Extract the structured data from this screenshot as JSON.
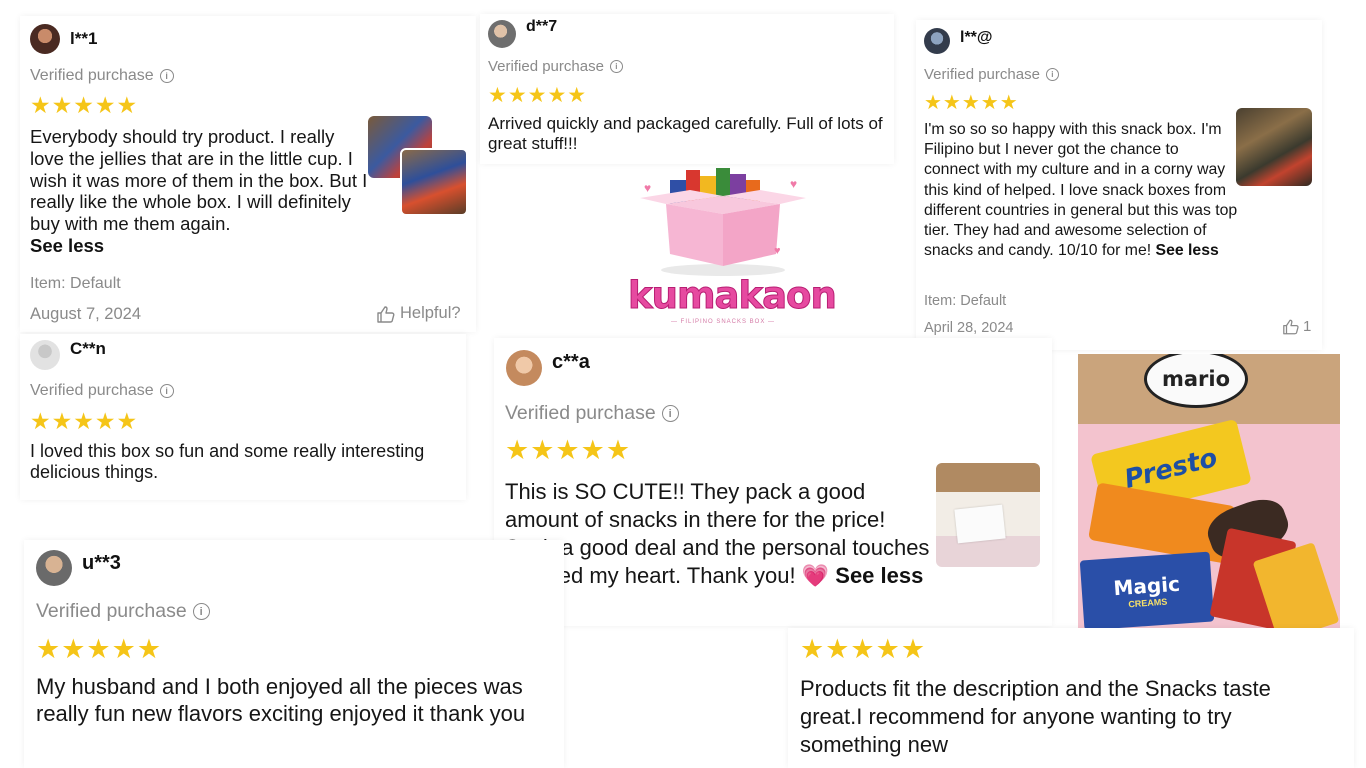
{
  "common": {
    "verified": "Verified purchase",
    "stars": "★★★★★",
    "see_less": "See less",
    "item": "Item: Default"
  },
  "reviews": [
    {
      "user": "l**1",
      "text": "Everybody should try product. I really love the jellies that are in the little cup. I wish it was more of them in the box. But I really like the whole box. I will definitely buy with me them again.",
      "date": "August 7, 2024",
      "helpful": "Helpful?"
    },
    {
      "user": "d**7",
      "text": "Arrived quickly and packaged carefully. Full of lots of great stuff!!!"
    },
    {
      "user": "l**@",
      "text": "I'm so so so happy with this snack box. I'm Filipino but I never got the chance to connect with my culture and in a corny way this kind of helped. I love snack boxes from different countries in general but this was top tier. They had and awesome selection of snacks and candy. 10/10 for me!",
      "date": "April 28, 2024",
      "helpful_count": "1"
    },
    {
      "user": "C**n",
      "text": "I loved this box so fun and some really interesting delicious things."
    },
    {
      "user": "c**a",
      "text": "This is SO CUTE!! They pack a good amount of snacks in there for the price! Such a good deal and the personal touches warmed my heart. Thank you!",
      "emoji": "💗"
    },
    {
      "user": "u**3",
      "text": "My husband and I both enjoyed all the pieces was really fun new flavors exciting enjoyed it thank you"
    },
    {
      "text": "Products fit the description and the Snacks taste great.I recommend for anyone wanting to try something new"
    }
  ],
  "logo": {
    "brand": "kumakaon",
    "tagline": "— FILIPINO SNACKS BOX —"
  },
  "photo": {
    "lid_text": "mario",
    "snack1": "Presto",
    "snack2": "Magic",
    "snack2_sub": "CREAMS"
  },
  "colors": {
    "star": "#f5c518",
    "brand_pink": "#e64aa0",
    "box_pink": "#f6b6d3"
  }
}
